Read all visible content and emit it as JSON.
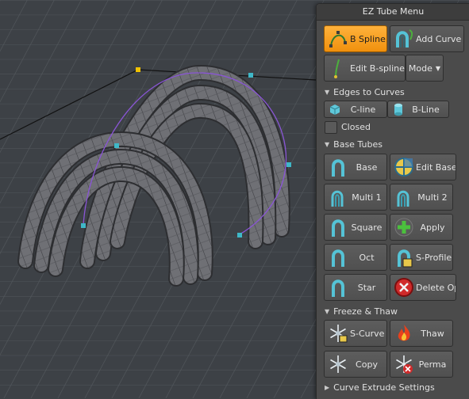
{
  "panel": {
    "title": "EZ Tube Menu"
  },
  "top_buttons": {
    "b_spline": "B Spline",
    "add_curve": "Add Curve",
    "edit_bspline": "Edit B-spline",
    "mode": "Mode",
    "mode_arrow": "▼"
  },
  "edges_to_curves": {
    "header": "Edges to Curves",
    "c_line": "C-line",
    "b_line": "B-Line",
    "closed_label": "Closed",
    "closed_checked": false
  },
  "base_tubes": {
    "header": "Base Tubes",
    "base": "Base",
    "edit_base": "Edit Base",
    "multi1": "Multi 1",
    "multi2": "Multi 2",
    "square": "Square",
    "apply": "Apply",
    "oct": "Oct",
    "s_profile": "S-Profile",
    "star": "Star",
    "delete_op": "Delete Op"
  },
  "freeze_thaw": {
    "header": "Freeze & Thaw",
    "s_curve": "S-Curve",
    "thaw": "Thaw",
    "copy": "Copy",
    "perma": "Perma"
  },
  "curve_extrude": {
    "header": "Curve Extrude Settings"
  },
  "colors": {
    "active": "#f39a1c",
    "panel": "#4b4b4b",
    "viewport": "#3e4246",
    "tube": "#6f7075",
    "curve": "#8a55d6",
    "control_point": "#3fb8c8",
    "selected_point": "#f1c200"
  },
  "icons": {
    "section_arrow": "▼",
    "collapsed_arrow": "▶"
  }
}
